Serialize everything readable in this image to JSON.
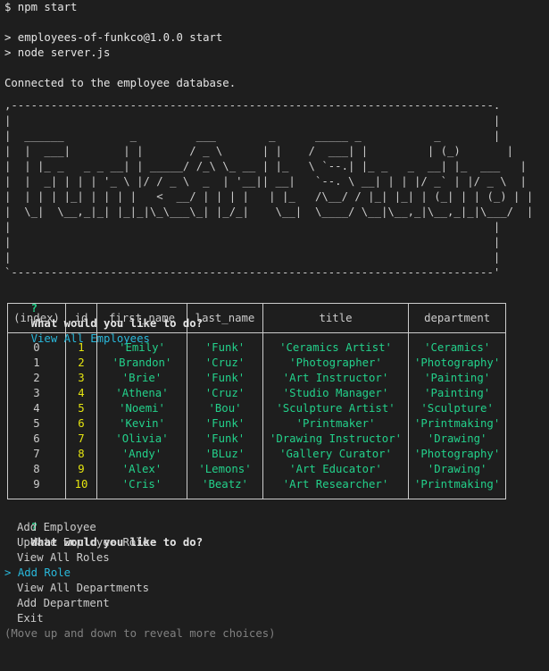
{
  "session": {
    "command": "$ npm start",
    "npm_line1": "> employees-of-funkco@1.0.0 start",
    "npm_line2": "> node server.js",
    "db_message": "Connected to the employee database."
  },
  "banner": {
    "lines": [
      ",-------------------------------------------------------------------------.",
      "|                                                                         |",
      "|  ______          _         ___        _      _____ _           _        |",
      "|  |  ___|        | |       / _ \\      | |    /  ___| |         | (_)       |",
      "|  | |_ _   _ _ __| | _____/ /_\\ \\_ __ | |_   \\ `--.| |_ _   _  __| |_  ___   |",
      "|  |  _| | | | '_ \\ |/ / _ \\  _  | '__|| __|   `--. \\ __| | | |/ _` | |/ _ \\  |",
      "|  | | | |_| | | | |   <  __/ | | | |   | |_   /\\__/ / |_| |_| | (_| | | (_) | |",
      "|  \\_|  \\__,_|_| |_|_|\\_\\___\\_| |_/_|    \\__|  \\____/ \\__|\\__,_|\\__,_|_|\\___/  |",
      "|                                                                         |",
      "|                                                                         |",
      "|                                                                         |",
      "`-------------------------------------------------------------------------'"
    ]
  },
  "prompt1": {
    "mark": "?",
    "question": "What would you like to do?",
    "answer": "View All Employees"
  },
  "table": {
    "headers": [
      "(index)",
      "id",
      "first_name",
      "last_name",
      "title",
      "department"
    ],
    "rows": [
      {
        "index": "0",
        "id": "1",
        "first_name": "'Emily'",
        "last_name": "'Funk'",
        "title": "'Ceramics Artist'",
        "department": "'Ceramics'"
      },
      {
        "index": "1",
        "id": "2",
        "first_name": "'Brandon'",
        "last_name": "'Cruz'",
        "title": "'Photographer'",
        "department": "'Photography'"
      },
      {
        "index": "2",
        "id": "3",
        "first_name": "'Brie'",
        "last_name": "'Funk'",
        "title": "'Art Instructor'",
        "department": "'Painting'"
      },
      {
        "index": "3",
        "id": "4",
        "first_name": "'Athena'",
        "last_name": "'Cruz'",
        "title": "'Studio Manager'",
        "department": "'Painting'"
      },
      {
        "index": "4",
        "id": "5",
        "first_name": "'Noemi'",
        "last_name": "'Bou'",
        "title": "'Sculpture Artist'",
        "department": "'Sculpture'"
      },
      {
        "index": "5",
        "id": "6",
        "first_name": "'Kevin'",
        "last_name": "'Funk'",
        "title": "'Printmaker'",
        "department": "'Printmaking'"
      },
      {
        "index": "6",
        "id": "7",
        "first_name": "'Olivia'",
        "last_name": "'Funk'",
        "title": "'Drawing Instructor'",
        "department": "'Drawing'"
      },
      {
        "index": "7",
        "id": "8",
        "first_name": "'Andy'",
        "last_name": "'BLuz'",
        "title": "'Gallery Curator'",
        "department": "'Photography'"
      },
      {
        "index": "8",
        "id": "9",
        "first_name": "'Alex'",
        "last_name": "'Lemons'",
        "title": "'Art Educator'",
        "department": "'Drawing'"
      },
      {
        "index": "9",
        "id": "10",
        "first_name": "'Cris'",
        "last_name": "'Beatz'",
        "title": "'Art Researcher'",
        "department": "'Printmaking'"
      }
    ]
  },
  "prompt2": {
    "mark": "?",
    "question": "What would you like to do?",
    "pointer": ">",
    "choices": [
      {
        "label": "Add Employee",
        "selected": false
      },
      {
        "label": "Update Employee Role",
        "selected": false
      },
      {
        "label": "View All Roles",
        "selected": false
      },
      {
        "label": "Add Role",
        "selected": true
      },
      {
        "label": "View All Departments",
        "selected": false
      },
      {
        "label": "Add Department",
        "selected": false
      },
      {
        "label": "Exit",
        "selected": false
      }
    ],
    "hint": "(Move up and down to reveal more choices)"
  },
  "colors": {
    "background": "#1e1e1e",
    "foreground": "#cccccc",
    "green": "#23d18b",
    "cyan": "#29b8db",
    "yellow": "#e5e510",
    "gray": "#808080"
  }
}
